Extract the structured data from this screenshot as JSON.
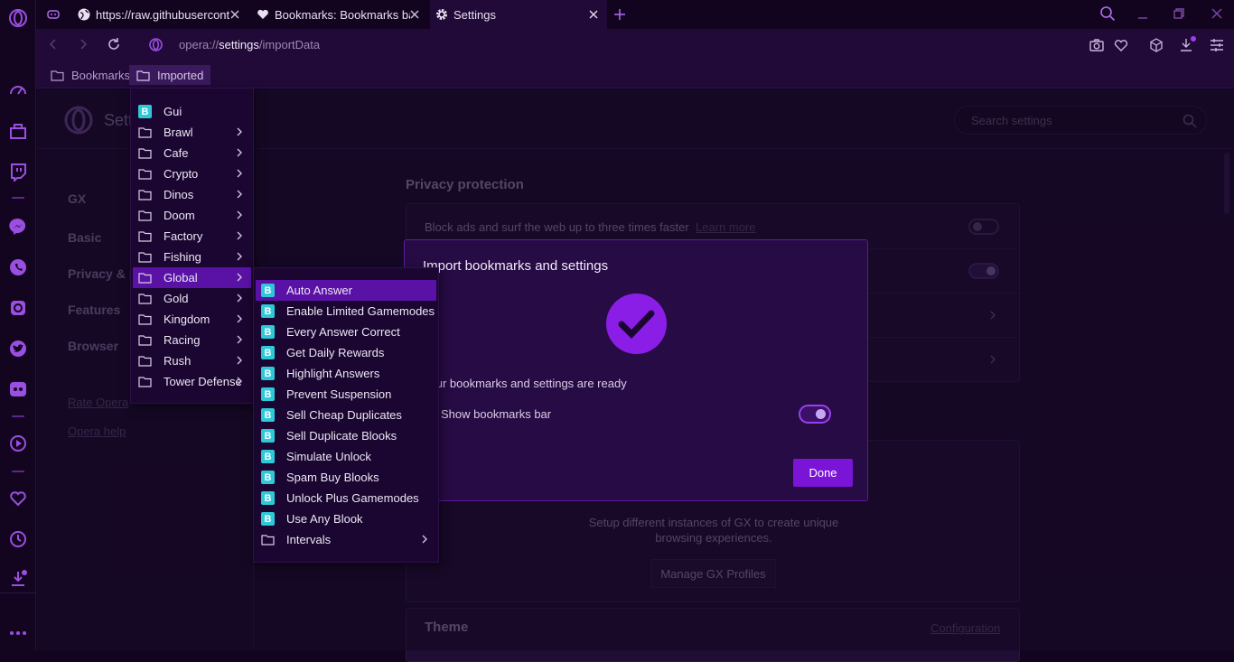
{
  "colors": {
    "accent": "#8a1ee6",
    "background": "#12041f",
    "menu_highlight": "#5a12a6",
    "bookmark_icon": "#2ec8d8"
  },
  "tabs": [
    {
      "title": "",
      "icon": "gamepad-icon"
    },
    {
      "title": "https://raw.githubuserconte",
      "icon": "globe-icon"
    },
    {
      "title": "Bookmarks: Bookmarks bar",
      "icon": "heart-icon"
    },
    {
      "title": "Settings",
      "icon": "gear-icon",
      "active": true
    }
  ],
  "address": {
    "scheme": "opera://",
    "host": "settings",
    "path": "/importData"
  },
  "bookmarks_bar": {
    "items": [
      "Bookmarks",
      "Imported"
    ]
  },
  "settings": {
    "header_title": "Setti",
    "search_placeholder": "Search settings",
    "nav": [
      "GX",
      "Basic",
      "Privacy & s",
      "Features",
      "Browser"
    ],
    "links": [
      "Rate Opera",
      "Opera help"
    ],
    "section_privacy": "Privacy protection",
    "row_block_ads": "Block ads and surf the web up to three times faster",
    "row_learn_more": "Learn more",
    "gx_profiles_desc": "Setup different instances of GX to create unique browsing experiences.",
    "manage_profiles": "Manage GX Profiles",
    "section_theme": "Theme",
    "configuration": "Configuration"
  },
  "dialog": {
    "title": "Import bookmarks and settings",
    "message": "Your bookmarks and settings are ready",
    "show_bookmarks_bar": "Show bookmarks bar",
    "show_bookmarks_bar_on": true,
    "done": "Done"
  },
  "imported_menu": [
    {
      "label": "Gui",
      "type": "bookmark"
    },
    {
      "label": "Brawl",
      "type": "folder"
    },
    {
      "label": "Cafe",
      "type": "folder"
    },
    {
      "label": "Crypto",
      "type": "folder"
    },
    {
      "label": "Dinos",
      "type": "folder"
    },
    {
      "label": "Doom",
      "type": "folder"
    },
    {
      "label": "Factory",
      "type": "folder"
    },
    {
      "label": "Fishing",
      "type": "folder"
    },
    {
      "label": "Global",
      "type": "folder",
      "highlighted": true
    },
    {
      "label": "Gold",
      "type": "folder"
    },
    {
      "label": "Kingdom",
      "type": "folder"
    },
    {
      "label": "Racing",
      "type": "folder"
    },
    {
      "label": "Rush",
      "type": "folder"
    },
    {
      "label": "Tower Defense",
      "type": "folder"
    }
  ],
  "global_menu": [
    {
      "label": "Auto Answer",
      "type": "bookmark",
      "highlighted": true
    },
    {
      "label": "Enable Limited Gamemodes",
      "type": "bookmark"
    },
    {
      "label": "Every Answer Correct",
      "type": "bookmark"
    },
    {
      "label": "Get Daily Rewards",
      "type": "bookmark"
    },
    {
      "label": "Highlight Answers",
      "type": "bookmark"
    },
    {
      "label": "Prevent Suspension",
      "type": "bookmark"
    },
    {
      "label": "Sell Cheap Duplicates",
      "type": "bookmark"
    },
    {
      "label": "Sell Duplicate Blooks",
      "type": "bookmark"
    },
    {
      "label": "Simulate Unlock",
      "type": "bookmark"
    },
    {
      "label": "Spam Buy Blooks",
      "type": "bookmark"
    },
    {
      "label": "Unlock Plus Gamemodes",
      "type": "bookmark"
    },
    {
      "label": "Use Any Blook",
      "type": "bookmark"
    },
    {
      "label": "Intervals",
      "type": "folder"
    }
  ],
  "bookmark_glyph": "B"
}
